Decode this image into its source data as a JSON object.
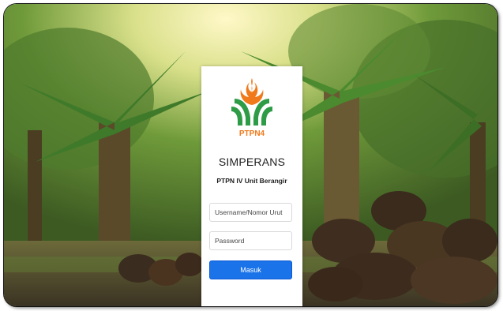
{
  "background": {
    "description": "oil palm plantation with fresh fruit bunches"
  },
  "logo": {
    "text": "PTPN4",
    "leaf_color": "#2e9b46",
    "flame_color": "#f07a1b"
  },
  "login": {
    "title": "SIMPERANS",
    "subtitle": "PTPN IV Unit Berangir",
    "username_placeholder": "Username/Nomor Urut",
    "password_placeholder": "Password",
    "submit_label": "Masuk"
  },
  "colors": {
    "button": "#1a73e8",
    "card": "#ffffff"
  }
}
